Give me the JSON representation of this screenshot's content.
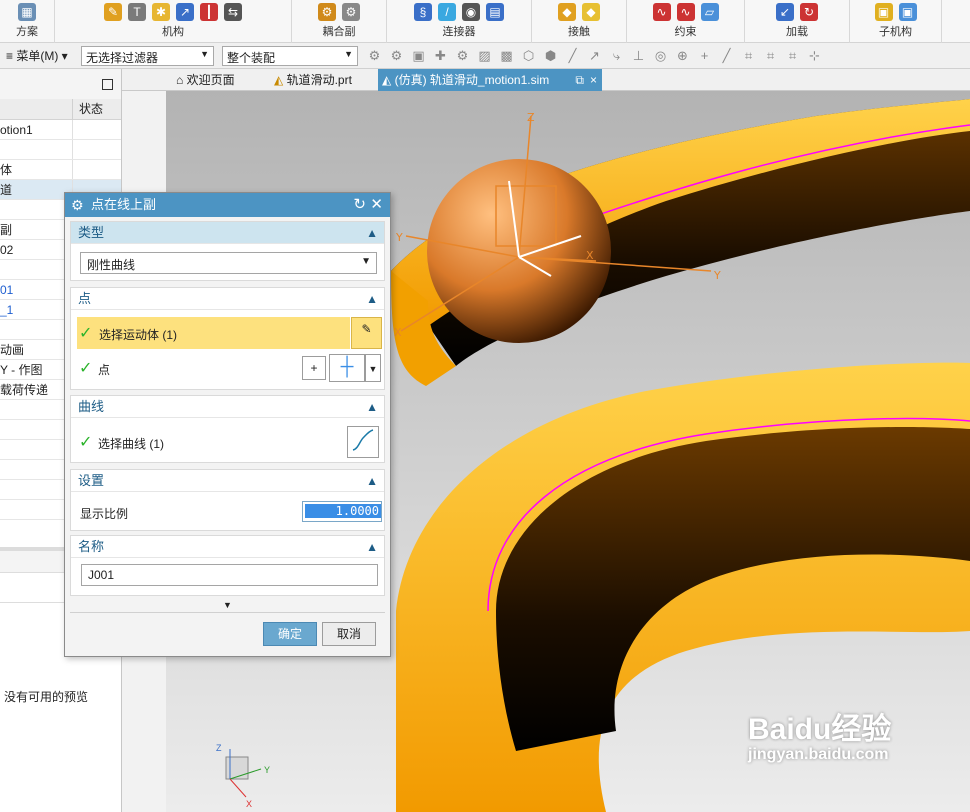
{
  "ribbon": {
    "groups": [
      {
        "label": "方案"
      },
      {
        "label": "机构"
      },
      {
        "label": "耦合副"
      },
      {
        "label": "连接器"
      },
      {
        "label": "接触"
      },
      {
        "label": "约束"
      },
      {
        "label": "加载"
      },
      {
        "label": "子机构"
      }
    ]
  },
  "toolbar": {
    "menu_label": "菜单(M)",
    "filter_value": "无选择过滤器",
    "assembly_value": "整个装配"
  },
  "tabs": [
    {
      "label": "欢迎页面"
    },
    {
      "label": "轨道滑动.prt"
    },
    {
      "label": "(仿真) 轨道滑动_motion1.sim"
    }
  ],
  "navigator": {
    "col_status": "状态",
    "rows": [
      "otion1",
      "",
      "体",
      "道",
      "",
      "副",
      "02",
      "",
      "01",
      "_1",
      "",
      "动画",
      "Y - 作图",
      "载荷传递",
      "",
      "",
      "",
      "",
      "",
      ""
    ],
    "preview_text": "没有可用的预览"
  },
  "dialog": {
    "title": "点在线上副",
    "sections": {
      "type": {
        "label": "类型",
        "value": "刚性曲线"
      },
      "point": {
        "label": "点",
        "select_body": "选择运动体 (1)",
        "point_label": "点"
      },
      "curve": {
        "label": "曲线",
        "select_curve": "选择曲线 (1)"
      },
      "settings": {
        "label": "设置",
        "scale_label": "显示比例",
        "scale_value": "1.0000"
      },
      "name": {
        "label": "名称",
        "value": "J001"
      }
    },
    "ok_label": "确定",
    "cancel_label": "取消"
  },
  "viewport": {
    "axis_labels": {
      "z": "Z",
      "y": "Y",
      "x": "X"
    }
  },
  "watermark": {
    "brand": "Baidu经验",
    "url": "jingyan.baidu.com"
  },
  "colors": {
    "accent": "#4c94c3",
    "highlight": "#fde17e",
    "track": "#f5a400",
    "curve": "#ff00ff"
  }
}
